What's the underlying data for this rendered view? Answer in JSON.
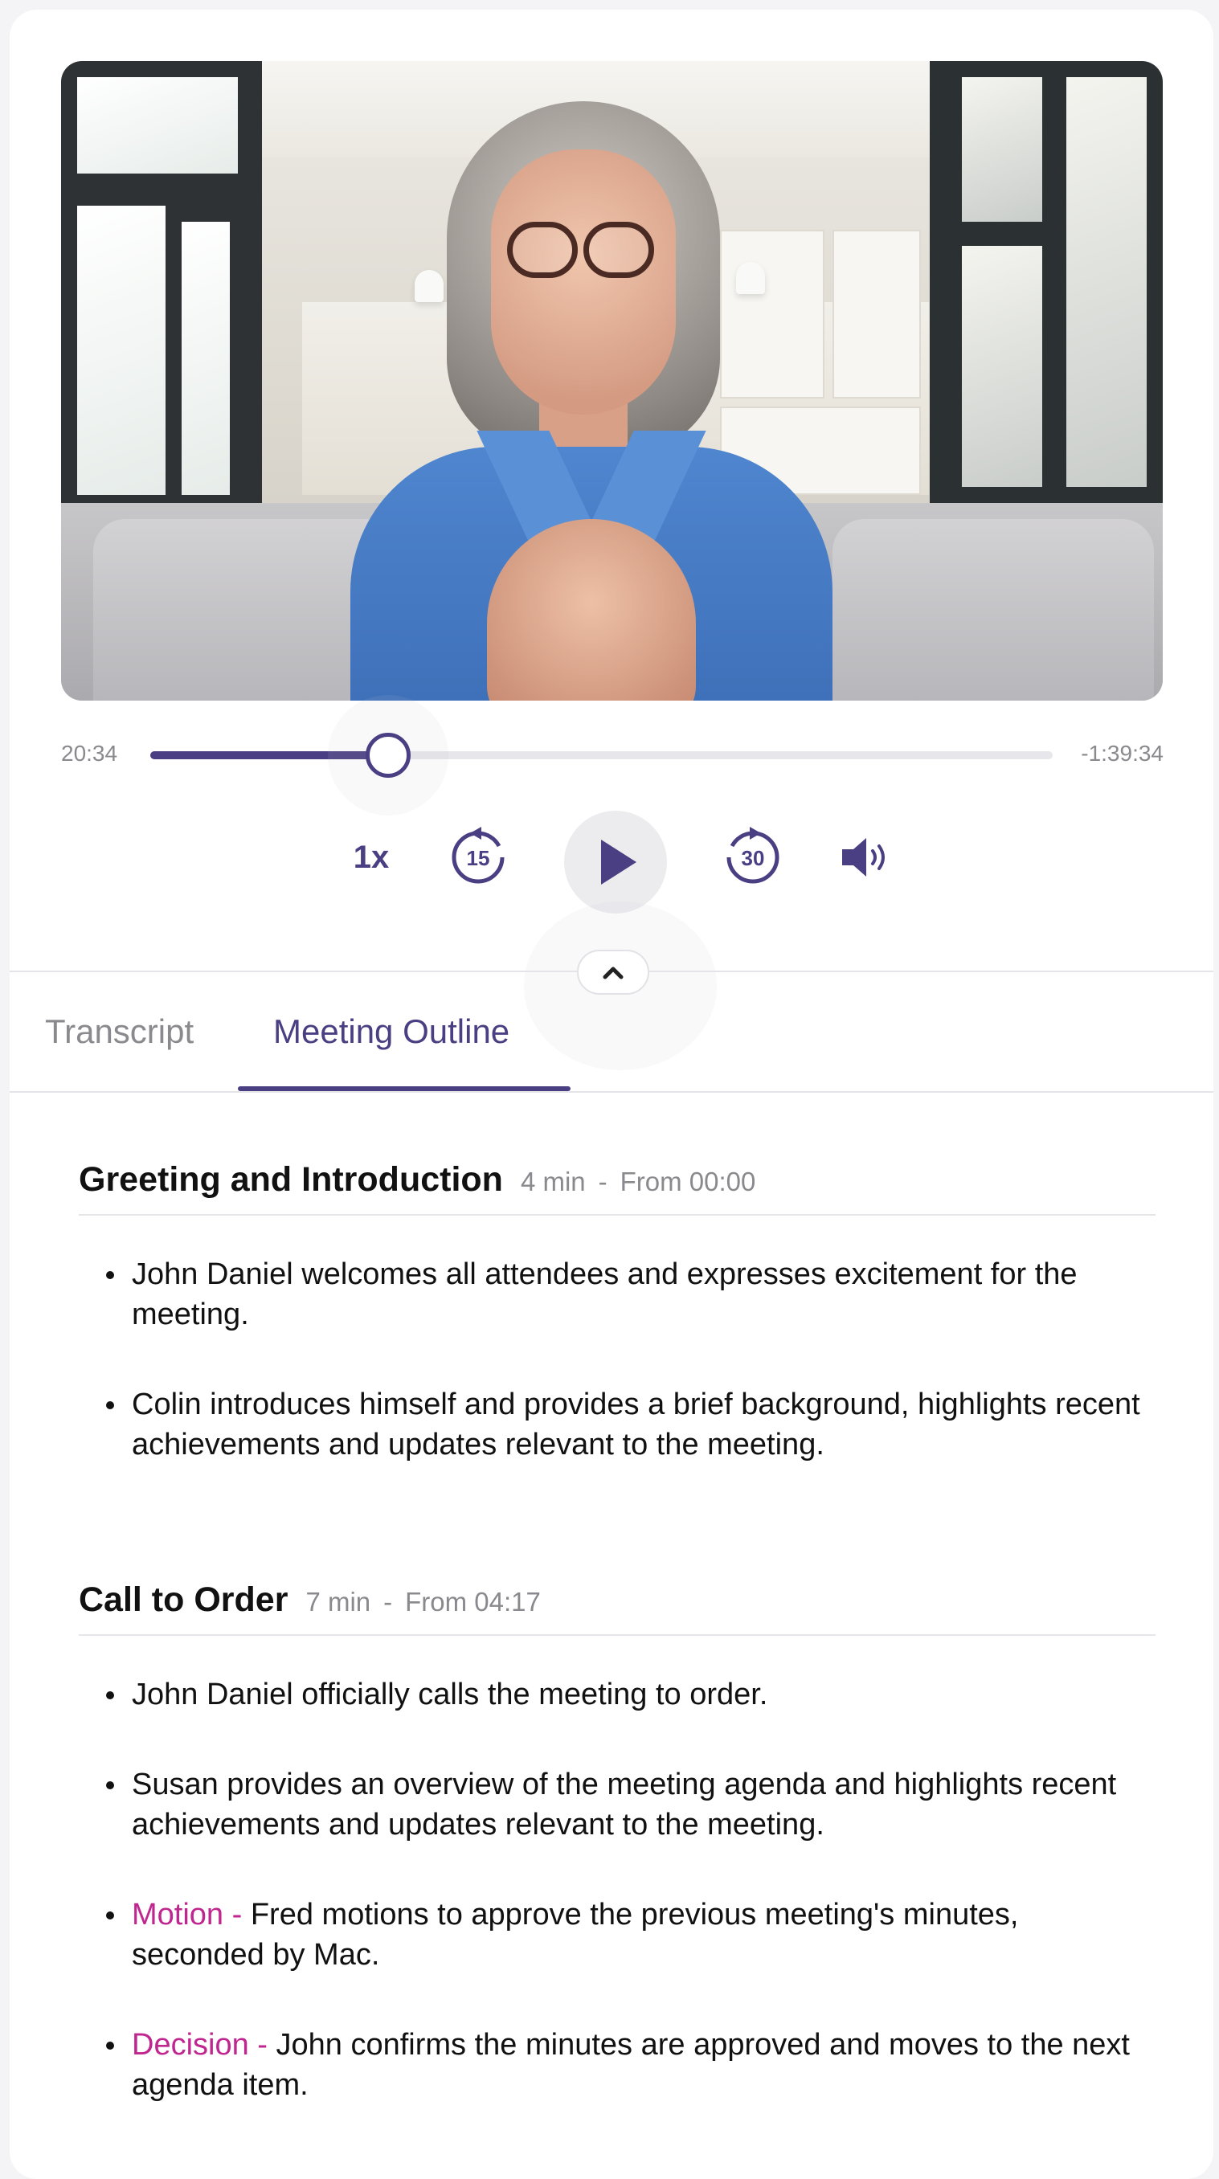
{
  "player": {
    "elapsed": "20:34",
    "remaining": "-1:39:34",
    "progress_percent": 26.4,
    "speed": "1x",
    "skip_back_seconds": "15",
    "skip_forward_seconds": "30",
    "accent_color": "#4b3f83",
    "icons": [
      "skip-back-15-icon",
      "play-icon",
      "skip-forward-30-icon",
      "volume-icon",
      "chevron-up-icon"
    ]
  },
  "tabs": [
    {
      "label": "Transcript",
      "active": false
    },
    {
      "label": "Meeting Outline",
      "active": true
    }
  ],
  "outline": [
    {
      "title": "Greeting and Introduction",
      "duration": "4 min",
      "separator": "-",
      "from": "From 00:00",
      "items": [
        {
          "tag": "",
          "text": "John Daniel welcomes all attendees and expresses excitement for the meeting."
        },
        {
          "tag": "",
          "text": "Colin introduces himself and provides a brief background, highlights recent achievements and updates relevant to the meeting."
        }
      ]
    },
    {
      "title": "Call to Order",
      "duration": "7 min",
      "separator": "-",
      "from": "From 04:17",
      "items": [
        {
          "tag": "",
          "text": "John Daniel officially calls the meeting to order."
        },
        {
          "tag": "",
          "text": "Susan provides an overview of the meeting agenda and highlights recent achievements and updates relevant to the meeting."
        },
        {
          "tag": "Motion -",
          "text": "Fred motions to approve the previous meeting's minutes, seconded by Mac."
        },
        {
          "tag": "Decision -",
          "text": "John confirms the minutes are approved and moves to the next agenda item."
        }
      ]
    }
  ],
  "tag_color": "#c0268f"
}
